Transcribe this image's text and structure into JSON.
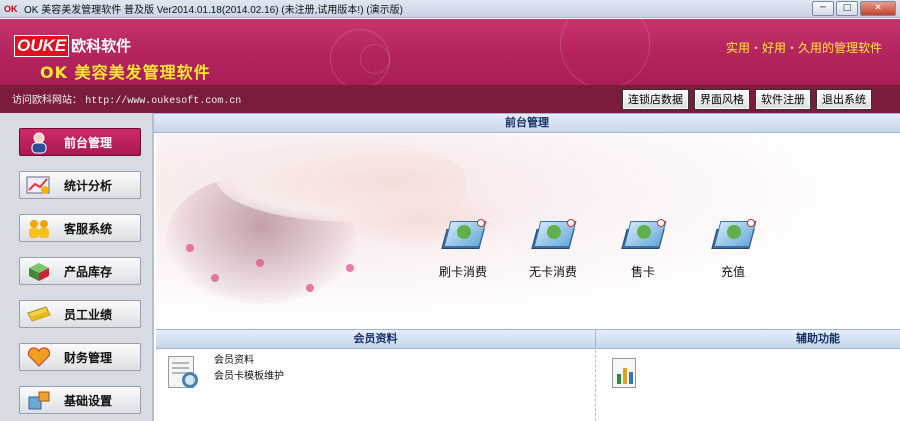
{
  "window": {
    "icon_text": "OK",
    "title": "OK 美容美发管理软件 普及版 Ver2014.01.18(2014.02.16) (未注册,试用版本!) (演示版)",
    "minimize": "─",
    "maximize": "□",
    "close": "✕"
  },
  "banner": {
    "brand_latin": "OUKE",
    "brand_cn": "欧科软件",
    "product": "OK 美容美发管理软件",
    "slogan": "实用・好用・久用的管理软件"
  },
  "urlbar": {
    "label": "访问欧科网站：",
    "url": "http://www.oukesoft.com.cn",
    "buttons": [
      "连锁店数据",
      "界面风格",
      "软件注册",
      "退出系统"
    ]
  },
  "sidebar": {
    "items": [
      {
        "label": "前台管理",
        "icon": "person-icon",
        "active": true
      },
      {
        "label": "统计分析",
        "icon": "chart-icon",
        "active": false
      },
      {
        "label": "客服系统",
        "icon": "people-icon",
        "active": false
      },
      {
        "label": "产品库存",
        "icon": "box-icon",
        "active": false
      },
      {
        "label": "员工业绩",
        "icon": "folder-icon",
        "active": false
      },
      {
        "label": "财务管理",
        "icon": "heart-icon",
        "active": false
      },
      {
        "label": "基础设置",
        "icon": "tools-icon",
        "active": false
      }
    ]
  },
  "main": {
    "front_title": "前台管理",
    "actions": [
      "刷卡消费",
      "无卡消费",
      "售卡",
      "充值"
    ],
    "member_title": "会员资料",
    "member_links": [
      "会员资料",
      "会员卡模板维护"
    ],
    "aux_title": "辅助功能"
  },
  "colors": {
    "banner": "#b52560",
    "urlbar": "#7a1c3a",
    "slogan": "#ffe63a",
    "active_nav": "#c02463"
  }
}
